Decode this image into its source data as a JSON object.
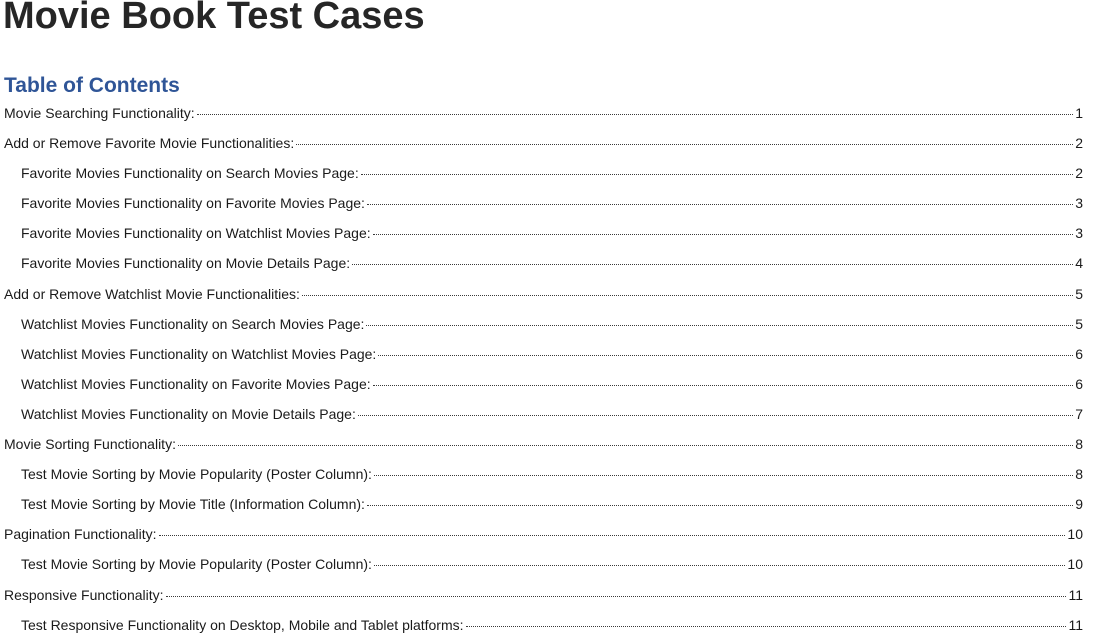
{
  "document": {
    "title": "Movie Book Test Cases"
  },
  "toc": {
    "heading": "Table of Contents",
    "entries": [
      {
        "label": "Movie Searching Functionality:",
        "page": "1",
        "level": 1
      },
      {
        "label": "Add or Remove Favorite Movie Functionalities:",
        "page": "2",
        "level": 1
      },
      {
        "label": "Favorite Movies Functionality on Search Movies Page:",
        "page": "2",
        "level": 2
      },
      {
        "label": "Favorite Movies Functionality on Favorite Movies Page:",
        "page": "3",
        "level": 2
      },
      {
        "label": "Favorite Movies Functionality on Watchlist Movies Page:",
        "page": "3",
        "level": 2
      },
      {
        "label": "Favorite Movies Functionality on Movie Details Page:",
        "page": "4",
        "level": 2
      },
      {
        "label": "Add or Remove Watchlist Movie Functionalities:",
        "page": "5",
        "level": 1
      },
      {
        "label": "Watchlist Movies Functionality on Search Movies Page:",
        "page": "5",
        "level": 2
      },
      {
        "label": "Watchlist Movies Functionality on Watchlist Movies Page:",
        "page": "6",
        "level": 2
      },
      {
        "label": "Watchlist Movies Functionality on Favorite Movies Page:",
        "page": "6",
        "level": 2
      },
      {
        "label": "Watchlist Movies Functionality on Movie Details Page:",
        "page": "7",
        "level": 2
      },
      {
        "label": "Movie Sorting Functionality:",
        "page": "8",
        "level": 1
      },
      {
        "label": "Test Movie Sorting by Movie Popularity (Poster Column):",
        "page": "8",
        "level": 2
      },
      {
        "label": "Test Movie Sorting by Movie Title (Information Column):",
        "page": "9",
        "level": 2
      },
      {
        "label": "Pagination Functionality:",
        "page": "10",
        "level": 1
      },
      {
        "label": "Test Movie Sorting by Movie Popularity (Poster Column):",
        "page": "10",
        "level": 2
      },
      {
        "label": "Responsive Functionality:",
        "page": "11",
        "level": 1
      },
      {
        "label": "Test Responsive Functionality on Desktop, Mobile and Tablet platforms:",
        "page": "11",
        "level": 2
      }
    ]
  }
}
